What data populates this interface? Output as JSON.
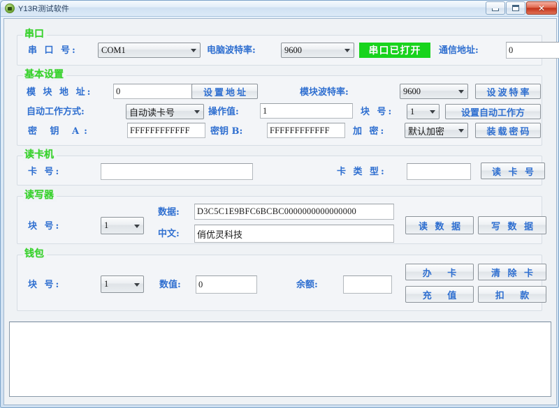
{
  "window": {
    "title": "Y13R测试软件",
    "icon": "app-icon",
    "minimize_label": "",
    "maximize_label": "",
    "close_label": "✕"
  },
  "serial_group": {
    "title": "串口",
    "port_label": "串 口 号:",
    "port_value": "COM1",
    "pc_baud_label": "电脑波特率:",
    "pc_baud_value": "9600",
    "status": "串口已打开",
    "status_color": "#18d41c",
    "comm_addr_label": "通信地址:",
    "comm_addr_value": "0"
  },
  "basic_group": {
    "title": "基本设置",
    "module_addr_label": "模 块 地 址:",
    "module_addr_value": "0",
    "set_addr_button": "设置地址",
    "module_baud_label": "模块波特率:",
    "module_baud_value": "9600",
    "set_baud_button": "设波特率",
    "auto_mode_label": "自动工作方式:",
    "auto_mode_value": "自动读卡号",
    "op_value_label": "操作值:",
    "op_value": "1",
    "block_label": "块     号:",
    "block_value": "1",
    "set_auto_button": "设置自动工作方",
    "key_a_label": "密  钥  A:",
    "key_a_value": "FFFFFFFFFFFF",
    "key_b_label": "密钥 B:",
    "key_b_value": "FFFFFFFFFFFF",
    "encrypt_label": "加     密:",
    "encrypt_value": "默认加密",
    "load_pwd_button": "装载密码"
  },
  "reader_group": {
    "title": "读卡机",
    "card_no_label": "卡     号:",
    "card_no_value": "",
    "card_type_label": "卡 类 型:",
    "card_type_value": "",
    "read_card_button": "读 卡 号"
  },
  "rw_group": {
    "title": "读写器",
    "block_label": "块     号:",
    "block_value": "1",
    "data_label": "数据:",
    "data_value": "D3C5C1E9BFC6BCBC0000000000000000",
    "chinese_label": "中文:",
    "chinese_value": "俏优灵科技",
    "read_data_button": "读 数 据",
    "write_data_button": "写 数 据"
  },
  "wallet_group": {
    "title": "钱包",
    "block_label": "块     号:",
    "block_value": "1",
    "amount_label": "数值:",
    "amount_value": "0",
    "balance_label": "余额:",
    "balance_value": "",
    "issue_card_button": "办     卡",
    "clear_card_button": "清 除 卡",
    "recharge_button": "充     值",
    "deduct_button": "扣     款"
  },
  "log": {
    "content": ""
  }
}
